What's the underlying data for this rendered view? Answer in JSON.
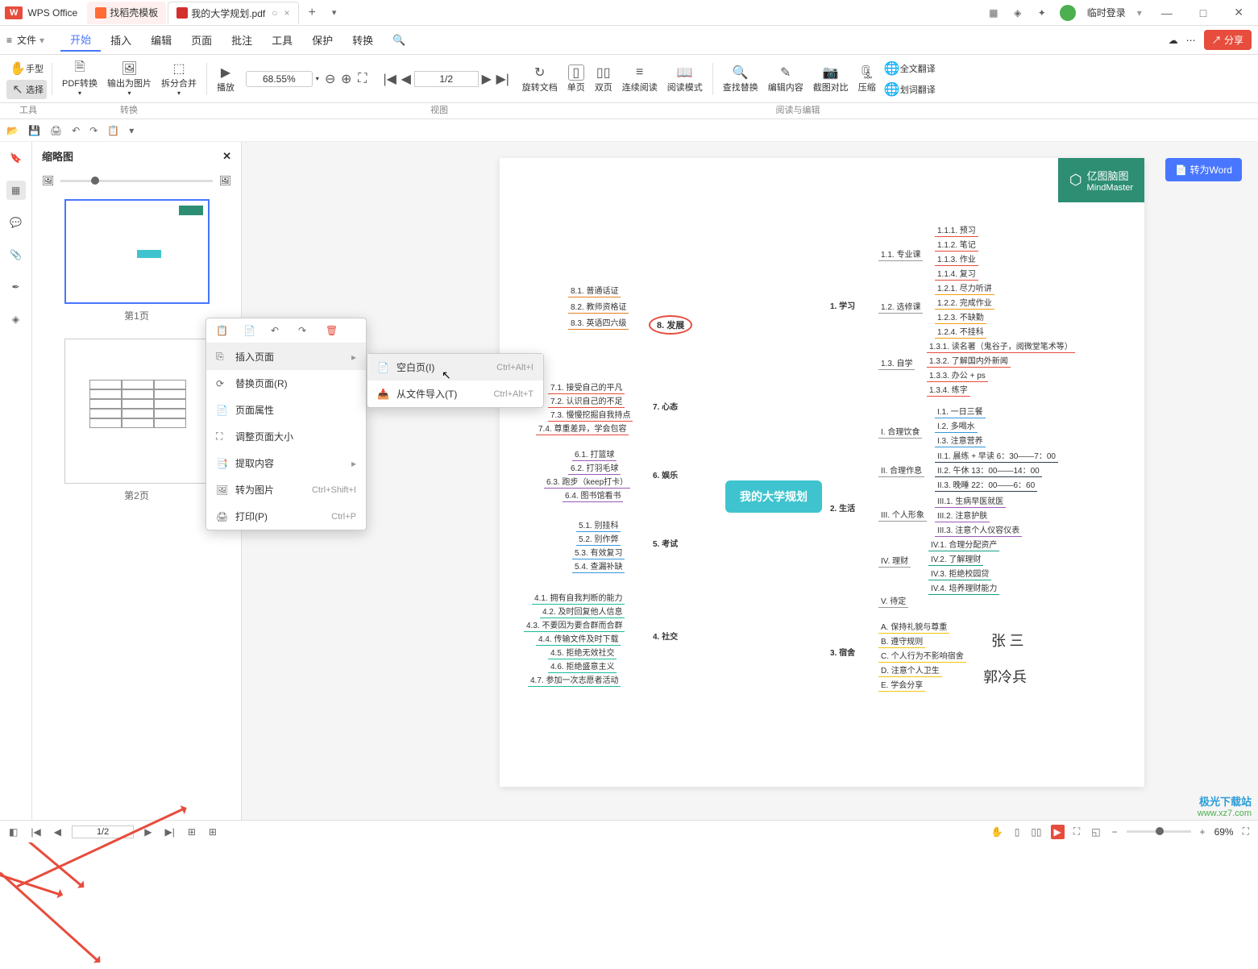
{
  "app_name": "WPS Office",
  "titlebar": {
    "tabs": [
      {
        "icon": "fire-icon",
        "label": "找稻壳模板"
      },
      {
        "icon": "pdf-icon",
        "label": "我的大学规划.pdf",
        "active": true
      }
    ],
    "login": "临时登录"
  },
  "menubar": {
    "file": "文件",
    "items": [
      "开始",
      "插入",
      "编辑",
      "页面",
      "批注",
      "工具",
      "保护",
      "转换"
    ],
    "active": "开始",
    "share": "分享"
  },
  "ribbon": {
    "tools": {
      "hand": "手型",
      "select": "选择",
      "groupLabel": "工具"
    },
    "convert": {
      "pdf": "PDF转换",
      "exportImg": "输出为图片",
      "split": "拆分合并",
      "groupLabel": "转换"
    },
    "play": "播放",
    "zoom": "68.55%",
    "pageInfo": "1/2",
    "rotate": "旋转文档",
    "single": "单页",
    "double": "双页",
    "continuous": "连续阅读",
    "readmode": "阅读模式",
    "viewLabel": "视图",
    "find": "查找替换",
    "editContent": "编辑内容",
    "screenshot": "截图对比",
    "compress": "压缩",
    "fulltrans": "全文翻译",
    "wordtrans": "划词翻译",
    "readEditLabel": "阅读与编辑"
  },
  "sidebar": {
    "title": "缩略图",
    "pages": [
      "第1页",
      "第2页"
    ]
  },
  "contextMenu": {
    "items": [
      {
        "icon": "insert-page-icon",
        "label": "插入页面",
        "arrow": true
      },
      {
        "icon": "replace-page-icon",
        "label": "替换页面(R)"
      },
      {
        "icon": "page-prop-icon",
        "label": "页面属性"
      },
      {
        "icon": "resize-icon",
        "label": "调整页面大小"
      },
      {
        "icon": "extract-icon",
        "label": "提取内容",
        "arrow": true
      },
      {
        "icon": "to-image-icon",
        "label": "转为图片",
        "shortcut": "Ctrl+Shift+I"
      },
      {
        "icon": "print-icon",
        "label": "打印(P)",
        "shortcut": "Ctrl+P"
      }
    ]
  },
  "submenu": {
    "items": [
      {
        "icon": "blank-page-icon",
        "label": "空白页(I)",
        "shortcut": "Ctrl+Alt+I"
      },
      {
        "icon": "import-file-icon",
        "label": "从文件导入(T)",
        "shortcut": "Ctrl+Alt+T"
      }
    ]
  },
  "convertBtn": "转为Word",
  "logo": {
    "cn": "亿图脑图",
    "en": "MindMaster"
  },
  "mindmap": {
    "center": "我的大学规划",
    "topic8": "8. 发展",
    "left8": [
      "8.1. 普通话证",
      "8.2. 教师资格证",
      "8.3. 英语四六级"
    ],
    "topic7": "7. 心态",
    "left7": [
      "7.1. 接受自己的平凡",
      "7.2. 认识自己的不足",
      "7.3. 慢慢挖掘自我持点",
      "7.4. 尊重差异，学会包容"
    ],
    "topic6": "6. 娱乐",
    "left6": [
      "6.1. 打篮球",
      "6.2. 打羽毛球",
      "6.3. 跑步（keep打卡）",
      "6.4. 图书馆看书"
    ],
    "topic5": "5. 考试",
    "left5": [
      "5.1. 别挂科",
      "5.2. 别作弊",
      "5.3. 有效复习",
      "5.4. 查漏补缺"
    ],
    "topic4": "4. 社交",
    "left4": [
      "4.1. 拥有自我判断的能力",
      "4.2. 及时回复他人信息",
      "4.3. 不要因为要合群而合群",
      "4.4. 传输文件及时下载",
      "4.5. 拒绝无效社交",
      "4.6. 拒绝盛意主义",
      "4.7. 参加一次志愿者活动"
    ],
    "topic1": "1. 学习",
    "r1": [
      "1.1. 专业课",
      "1.2. 选修课",
      "1.3. 自学"
    ],
    "r11": [
      "1.1.1. 预习",
      "1.1.2. 笔记",
      "1.1.3. 作业",
      "1.1.4. 复习"
    ],
    "r12": [
      "1.2.1. 尽力听讲",
      "1.2.2. 完成作业",
      "1.2.3. 不缺勤",
      "1.2.4. 不挂科"
    ],
    "r13": [
      "1.3.1. 读名著（鬼谷子，阅微堂笔术等）",
      "1.3.2. 了解国内外新闻",
      "1.3.3. 办公 + ps",
      "1.3.4. 练字"
    ],
    "topic2": "2. 生活",
    "r2": [
      "I. 合理饮食",
      "II. 合理作息",
      "III. 个人形象",
      "IV. 理财",
      "V. 待定"
    ],
    "r21": [
      "I.1. 一日三餐",
      "I.2. 多喝水",
      "I.3. 注意营养"
    ],
    "r22": [
      "II.1. 晨练 + 早读 6：30——7：00",
      "II.2. 午休 13：00——14：00",
      "II.3. 晚睡 22：00——6：60"
    ],
    "r23": [
      "III.1. 生病早医就医",
      "III.2. 注意护肤",
      "III.3. 注意个人仪容仪表"
    ],
    "r24": [
      "IV.1. 合理分配资产",
      "IV.2. 了解理财",
      "IV.3. 拒绝校园贷",
      "IV.4. 培养理财能力"
    ],
    "topic3": "3. 宿舍",
    "r3": [
      "A. 保持礼貌与尊重",
      "B. 遵守规则",
      "C. 个人行为不影响宿舍",
      "D. 注意个人卫生",
      "E. 学会分享"
    ],
    "sig1": "张 三",
    "sig2": "郭冷兵"
  },
  "statusbar": {
    "page": "1/2",
    "zoom": "69%"
  },
  "watermark": {
    "site": "极光下载站",
    "url": "www.xz7.com"
  }
}
